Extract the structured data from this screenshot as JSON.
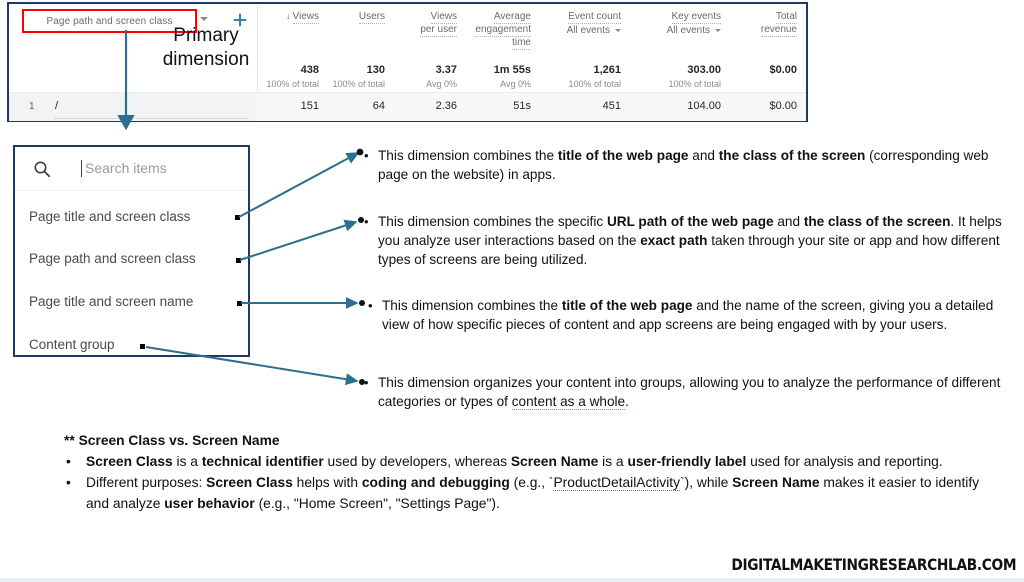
{
  "table": {
    "primary_dimension_cell": {
      "label": "Page path and screen class",
      "caret_icon": "chevron-down-icon",
      "add_icon": "plus-icon"
    },
    "columns": [
      {
        "title": "Views",
        "sort_icon": "sort-down-arrow",
        "sub": "",
        "total": "438",
        "total_sub": "100% of total",
        "row1": "151"
      },
      {
        "title": "Users",
        "sort_icon": "",
        "sub": "",
        "total": "130",
        "total_sub": "100% of total",
        "row1": "64"
      },
      {
        "title": "Views\nper user",
        "sort_icon": "",
        "sub": "",
        "total": "3.37",
        "total_sub": "Avg 0%",
        "row1": "2.36"
      },
      {
        "title": "Average\nengagement\ntime",
        "sort_icon": "",
        "sub": "",
        "total": "1m 55s",
        "total_sub": "Avg 0%",
        "row1": "51s"
      },
      {
        "title": "Event count",
        "sort_icon": "",
        "sub": "All events",
        "total": "1,261",
        "total_sub": "100% of total",
        "row1": "451"
      },
      {
        "title": "Key events",
        "sort_icon": "",
        "sub": "All events",
        "total": "303.00",
        "total_sub": "100% of total",
        "row1": "104.00"
      },
      {
        "title": "Total\nrevenue",
        "sort_icon": "",
        "sub": "",
        "total": "$0.00",
        "total_sub": "",
        "row1": "$0.00"
      }
    ],
    "row": {
      "index": "1",
      "path": "/"
    }
  },
  "annotations": {
    "primary_dimension": "Primary\ndimension"
  },
  "dropdown": {
    "search_placeholder": "Search items",
    "search_icon": "search-icon",
    "items": [
      "Page title and screen class",
      "Page path and screen class",
      "Page title and screen name",
      "Content group"
    ]
  },
  "descriptions": [
    {
      "html": "This dimension combines the <b>title of the web page</b> and <b>the class of the screen</b> (corresponding web page on the website) in apps."
    },
    {
      "html": "This dimension combines the specific <b>URL path of the web page</b> and <b>the class of the screen</b>. It helps you analyze user interactions based on the <b>exact path</b> taken through your site or app and how different types of screens are being utilized."
    },
    {
      "html": "This dimension combines the <b>title of the web page</b> and the name of the screen, giving you a detailed view of how specific pieces of content and app screens are being engaged with by your users."
    },
    {
      "html": "This dimension organizes your content into groups, allowing you to analyze the performance of different categories or types of <span class=\"squiggle\">content as a whole</span>."
    }
  ],
  "notes": {
    "heading": "** Screen Class vs. Screen Name",
    "items": [
      "<b>Screen Class</b> is a <b>technical identifier</b> used by developers, whereas <b>Screen Name</b> is a <b>user-friendly label</b> used for analysis and reporting.",
      "Different purposes: <b>Screen Class</b> helps with <b>coding and debugging</b> (e.g., `<span class=\"red-squiggle\">ProductDetailActivity</span>`), while <b>Screen Name</b> makes it easier to identify and analyze <b>user behavior</b> (e.g., \"Home Screen\", \"Settings Page\")."
    ]
  },
  "watermark": "DIGITALMAKETINGRESEARCHLAB.COM",
  "colors": {
    "accent_blue": "#2e6e8e",
    "highlight_red": "#ff0000",
    "panel_border": "#1f3864"
  }
}
